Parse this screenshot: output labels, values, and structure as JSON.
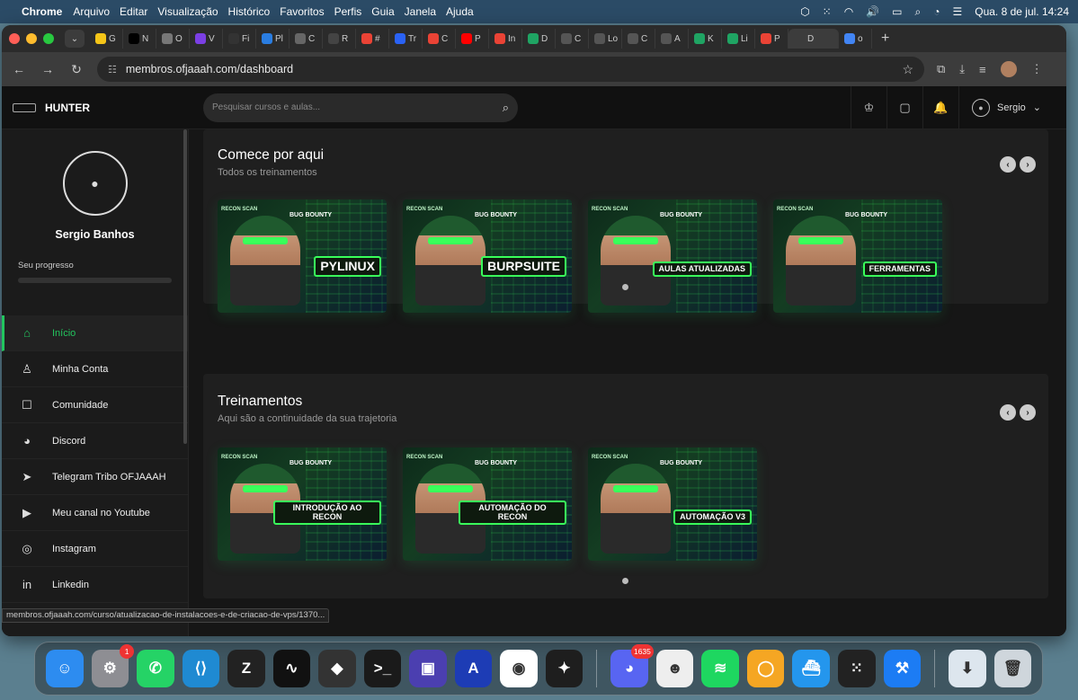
{
  "menubar": {
    "apple": "",
    "app": "Chrome",
    "items": [
      "Arquivo",
      "Editar",
      "Visualização",
      "Histórico",
      "Favoritos",
      "Perfis",
      "Guia",
      "Janela",
      "Ajuda"
    ],
    "clock": "Qua. 8 de jul.  14:24"
  },
  "browser": {
    "tabs": [
      "G",
      "N",
      "O",
      "V",
      "Fi",
      "Pl",
      "C",
      "R",
      "#",
      "Tr",
      "C",
      "P",
      "In",
      "D",
      "C",
      "Lo",
      "C",
      "A",
      "K",
      "Li",
      "P",
      "D",
      "o"
    ],
    "tab_colors": [
      "#f5c518",
      "#000000",
      "#777777",
      "#7b3fe4",
      "#333333",
      "#2a7de1",
      "#666666",
      "#444444",
      "#ea4335",
      "#2a62f5",
      "#ea4335",
      "#ff0000",
      "#ea4335",
      "#1fa463",
      "#555555",
      "#555555",
      "#555555",
      "#555555",
      "#1fa463",
      "#1fa463",
      "#ea4335",
      "#3c3c3c",
      "#4285f4"
    ],
    "url": "membros.ofjaaah.com/dashboard",
    "status_url": "membros.ofjaaah.com/curso/atualizacao-de-instalacoes-e-de-criacao-de-vps/1370..."
  },
  "site": {
    "brand": "HUNTER",
    "search_placeholder": "Pesquisar cursos e aulas...",
    "user_name": "Sergio"
  },
  "sidebar": {
    "profile_name": "Sergio Banhos",
    "progress_label": "Seu progresso",
    "progress_value": 0,
    "items": [
      {
        "label": "Início",
        "icon": "home-icon",
        "active": true
      },
      {
        "label": "Minha Conta",
        "icon": "user-icon"
      },
      {
        "label": "Comunidade",
        "icon": "chat-icon"
      },
      {
        "label": "Discord",
        "icon": "discord-icon"
      },
      {
        "label": "Telegram Tribo OFJAAAH",
        "icon": "telegram-icon"
      },
      {
        "label": "Meu canal no Youtube",
        "icon": "youtube-icon"
      },
      {
        "label": "Instagram",
        "icon": "instagram-icon"
      },
      {
        "label": "Linkedin",
        "icon": "linkedin-icon"
      }
    ]
  },
  "sections": [
    {
      "title": "Comece por aqui",
      "subtitle": "Todos os treinamentos",
      "cards": [
        {
          "title": "PYLINUX"
        },
        {
          "title": "BURPSUITE"
        },
        {
          "title": "AULAS ATUALIZADAS"
        },
        {
          "title": "FERRAMENTAS"
        }
      ]
    },
    {
      "title": "Treinamentos",
      "subtitle": "Aqui são a continuidade da sua trajetoria",
      "cards": [
        {
          "title": "INTRODUÇÃO AO RECON"
        },
        {
          "title": "AUTOMAÇÃO DO RECON"
        },
        {
          "title": "AUTOMAÇÃO V3"
        }
      ]
    }
  ],
  "card_labels": {
    "scan": "RECON SCAN",
    "bounty": "BUG BOUNTY"
  },
  "dock": {
    "apps": [
      {
        "name": "finder",
        "color": "#2d8cf0",
        "glyph": "☺"
      },
      {
        "name": "settings",
        "color": "#8e8e93",
        "glyph": "⚙",
        "badge": "1"
      },
      {
        "name": "whatsapp",
        "color": "#25d366",
        "glyph": "✆"
      },
      {
        "name": "vscode",
        "color": "#1f8ad2",
        "glyph": "⟨⟩"
      },
      {
        "name": "zed",
        "color": "#222222",
        "glyph": "Z"
      },
      {
        "name": "stocks",
        "color": "#111111",
        "glyph": "∿"
      },
      {
        "name": "box",
        "color": "#333333",
        "glyph": "◆"
      },
      {
        "name": "terminal",
        "color": "#1a1a1a",
        "glyph": ">_"
      },
      {
        "name": "screen",
        "color": "#4b3fb0",
        "glyph": "▣"
      },
      {
        "name": "arc",
        "color": "#1d3cb5",
        "glyph": "A"
      },
      {
        "name": "chrome",
        "color": "#ffffff",
        "glyph": "◉"
      },
      {
        "name": "figma",
        "color": "#1e1e1e",
        "glyph": "✦"
      },
      {
        "name": "discord",
        "color": "#5865f2",
        "glyph": "◕",
        "badge": "1635"
      },
      {
        "name": "beaver",
        "color": "#eeeeee",
        "glyph": "☻"
      },
      {
        "name": "spotify",
        "color": "#1ed760",
        "glyph": "≋"
      },
      {
        "name": "vpn",
        "color": "#f5a623",
        "glyph": "◯"
      },
      {
        "name": "docker",
        "color": "#2496ed",
        "glyph": "⛴"
      },
      {
        "name": "launchpad",
        "color": "#222222",
        "glyph": "⁙"
      },
      {
        "name": "xcode",
        "color": "#1c7cf4",
        "glyph": "⚒"
      },
      {
        "name": "downloads",
        "color": "#dde6ee",
        "glyph": "⬇"
      },
      {
        "name": "trash",
        "color": "#cfd6dc",
        "glyph": "🗑"
      }
    ]
  }
}
